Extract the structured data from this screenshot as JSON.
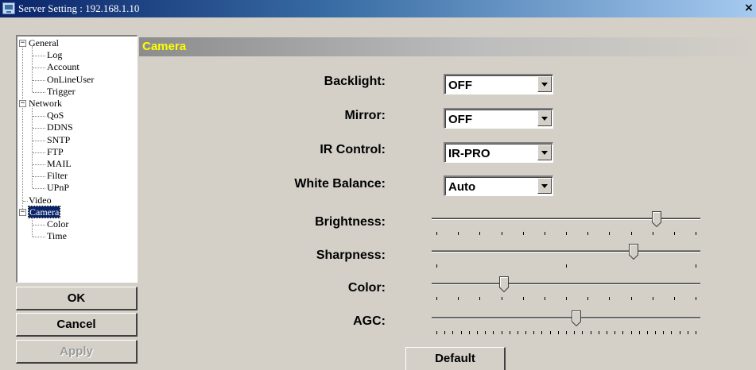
{
  "window": {
    "title": "Server Setting : 192.168.1.10",
    "close_glyph": "×"
  },
  "tree": {
    "nodes": [
      {
        "label": "General",
        "expander": "−"
      },
      {
        "label": "Log"
      },
      {
        "label": "Account"
      },
      {
        "label": "OnLineUser"
      },
      {
        "label": "Trigger"
      },
      {
        "label": "Network",
        "expander": "−"
      },
      {
        "label": "QoS"
      },
      {
        "label": "DDNS"
      },
      {
        "label": "SNTP"
      },
      {
        "label": "FTP"
      },
      {
        "label": "MAIL"
      },
      {
        "label": "Filter"
      },
      {
        "label": "UPnP"
      },
      {
        "label": "Video"
      },
      {
        "label": "Camera",
        "expander": "−",
        "selected": true
      },
      {
        "label": "Color"
      },
      {
        "label": "Time"
      }
    ]
  },
  "buttons": {
    "ok": "OK",
    "cancel": "Cancel",
    "apply": "Apply",
    "default": "Default"
  },
  "header": {
    "title": "Camera"
  },
  "settings": {
    "backlight": {
      "label": "Backlight:",
      "value": "OFF"
    },
    "mirror": {
      "label": "Mirror:",
      "value": "OFF"
    },
    "ir_control": {
      "label": "IR Control:",
      "value": "IR-PRO"
    },
    "white_balance": {
      "label": "White Balance:",
      "value": "Auto"
    }
  },
  "sliders": {
    "brightness": {
      "label": "Brightness:",
      "position": 0.85,
      "ticks": 13
    },
    "sharpness": {
      "label": "Sharpness:",
      "position": 0.76,
      "ticks": 3
    },
    "color": {
      "label": "Color:",
      "position": 0.26,
      "ticks": 13
    },
    "agc": {
      "label": "AGC:",
      "position": 0.54,
      "ticks": 33
    }
  },
  "colors": {
    "header_text": "#ffff00",
    "titlebar_start": "#0a246a",
    "selection": "#0a246a"
  },
  "icons": {
    "window": "server-window-icon",
    "close": "close-icon",
    "dropdown": "chevron-down-icon",
    "expander": "tree-collapse-icon"
  }
}
